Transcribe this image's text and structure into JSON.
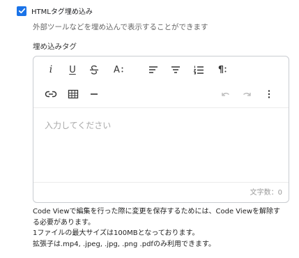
{
  "option": {
    "label": "HTMLタグ埋め込み",
    "checked": true,
    "description": "外部ツールなどを埋め込んで表示することができます"
  },
  "field": {
    "label": "埋め込みタグ"
  },
  "editor": {
    "toolbar_row1": [
      "italic",
      "underline",
      "strikethrough",
      "font-size",
      "align-left",
      "align-center",
      "numbered-list",
      "paragraph"
    ],
    "toolbar_row2": [
      "link",
      "table",
      "horizontal-rule",
      "undo",
      "redo",
      "more"
    ],
    "placeholder": "入力してください",
    "char_count": "文字数：0",
    "labels": {
      "italic": "i",
      "underline": "U",
      "font_size": "A",
      "paragraph": "¶"
    }
  },
  "help_lines": [
    "Code Viewで編集を行った際に変更を保存するためには、Code Viewを解除す",
    "る必要があります。",
    "1ファイルの最大サイズは100MBとなっております。",
    "拡張子は.mp4, .jpeg, .jpg, .png .pdfのみ利用できます。"
  ],
  "colors": {
    "checkbox": "#1a73e8",
    "border": "#c9ccd1",
    "placeholder": "#a8a8a8"
  }
}
